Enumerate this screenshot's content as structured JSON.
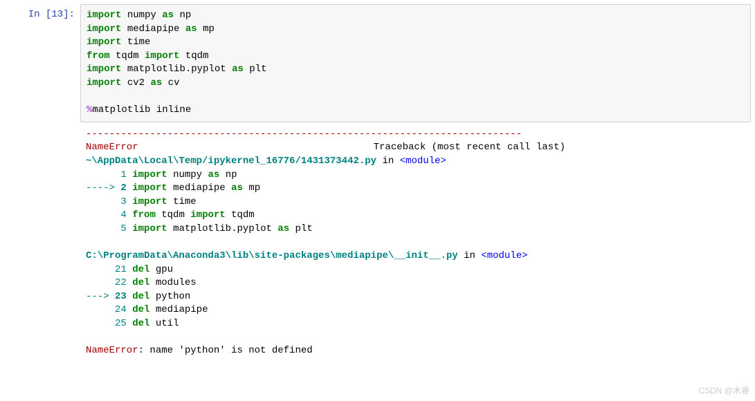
{
  "prompt": "In  [13]:",
  "code": {
    "l1": {
      "kw": "import",
      "mod": "numpy",
      "as": "as",
      "alias": "np"
    },
    "l2": {
      "kw": "import",
      "mod": "mediapipe",
      "as": "as",
      "alias": "mp"
    },
    "l3": {
      "kw": "import",
      "mod": "time"
    },
    "l4": {
      "kw1": "from",
      "mod": "tqdm",
      "kw2": "import",
      "name": "tqdm"
    },
    "l5": {
      "kw": "import",
      "mod": "matplotlib.pyplot",
      "as": "as",
      "alias": "plt"
    },
    "l6": {
      "kw": "import",
      "mod": "cv2",
      "as": "as",
      "alias": "cv"
    },
    "magic": {
      "pct": "%",
      "cmd": "matplotlib inline"
    }
  },
  "error": {
    "separator": "---------------------------------------------------------------------------",
    "name_error": "NameError",
    "traceback_label": "Traceback (most recent call last)",
    "file1": "~\\AppData\\Local\\Temp/ipykernel_16776/1431373442.py",
    "in_word": " in ",
    "module_tag": "<module>",
    "tb1": {
      "l1": {
        "num": "1",
        "kw": "import",
        "mod": "numpy",
        "as": "as",
        "alias": "np"
      },
      "arrow": "----> ",
      "l2": {
        "num": "2",
        "kw": "import",
        "mod": "mediapipe",
        "as": "as",
        "alias": "mp"
      },
      "l3": {
        "num": "3",
        "kw": "import",
        "mod": "time"
      },
      "l4": {
        "num": "4",
        "kw1": "from",
        "mod": "tqdm",
        "kw2": "import",
        "name": "tqdm"
      },
      "l5": {
        "num": "5",
        "kw": "import",
        "mod": "matplotlib.pyplot",
        "as": "as",
        "alias": "plt"
      }
    },
    "file2": "C:\\ProgramData\\Anaconda3\\lib\\site-packages\\mediapipe\\__init__.py",
    "tb2": {
      "l21": {
        "num": "21",
        "kw": "del",
        "name": "gpu"
      },
      "l22": {
        "num": "22",
        "kw": "del",
        "name": "modules"
      },
      "arrow": "---> ",
      "l23": {
        "num": "23",
        "kw": "del",
        "name": "python"
      },
      "l24": {
        "num": "24",
        "kw": "del",
        "name": "mediapipe"
      },
      "l25": {
        "num": "25",
        "kw": "del",
        "name": "util"
      }
    },
    "final_name": "NameError",
    "final_msg": ": name 'python' is not defined"
  },
  "watermark": "CSDN @木睿"
}
